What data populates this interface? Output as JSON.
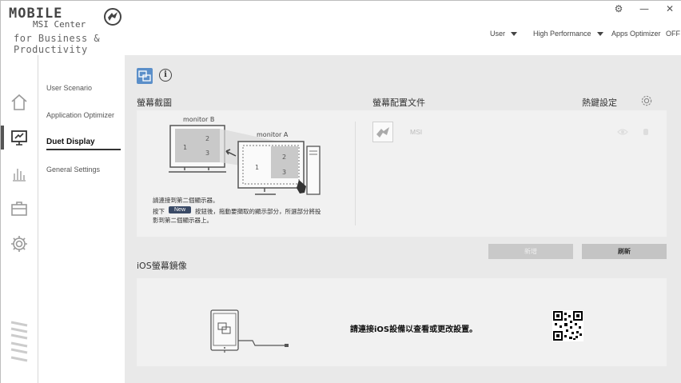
{
  "app": {
    "logo_line1": "MOBILE",
    "logo_line2": "MSI Center",
    "logo_line3": "for Business & Productivity"
  },
  "window_controls": {
    "settings": "⚙",
    "minimize": "—",
    "close": "✕"
  },
  "header_menu": {
    "user": "User",
    "performance": "High Performance",
    "apps_optimizer_label": "Apps Optimizer",
    "apps_optimizer_state": "OFF"
  },
  "rail": {
    "icons": [
      "home-icon",
      "monitor-icon",
      "chart-icon",
      "toolbox-icon",
      "gear-icon"
    ]
  },
  "subnav": {
    "items": [
      {
        "label": "User Scenario"
      },
      {
        "label": "Application Optimizer"
      },
      {
        "label": "Duet Display"
      },
      {
        "label": "General Settings"
      }
    ],
    "active_index": 2
  },
  "main": {
    "capture_title": "螢幕截圖",
    "profile_title": "螢幕配置文件",
    "hotkey_title": "熱鍵設定",
    "diagram": {
      "monitor_b": "monitor B",
      "monitor_a": "monitor A",
      "n1": "1",
      "n2": "2",
      "n3": "3"
    },
    "instr_line1": "請連接到第二個顯示器。",
    "instr_line2_pre": "按下",
    "instr_new": "New",
    "instr_line2_post": "按鈕後，拖動要擷取的顯示部分，所選部分將投",
    "instr_line3": "影到第二個顯示器上。",
    "profile_name": "MSI",
    "add_button": "新增",
    "refresh_button": "刷新",
    "ios_title": "iOS螢幕鏡像",
    "ios_message": "請連接iOS設備以查看或更改設置。"
  },
  "colors": {
    "accent": "#5b8fc9",
    "new_badge": "#3a4a66",
    "panel": "#f1f1f1",
    "background": "#e9e9e9"
  }
}
